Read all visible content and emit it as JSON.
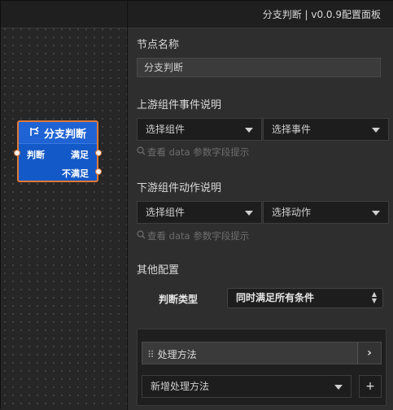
{
  "node": {
    "title": "分支判断",
    "title_icon": "branch-icon",
    "left_port_label": "判断",
    "out_labels": [
      "满足",
      "不满足"
    ]
  },
  "panel": {
    "title": "分支判断 | v0.0.9配置面板",
    "node_name_label": "节点名称",
    "node_name_value": "分支判断",
    "upstream": {
      "label": "上游组件事件说明",
      "component_select": "选择组件",
      "event_select": "选择事件",
      "hint": "查看 data 参数字段提示"
    },
    "downstream": {
      "label": "下游组件动作说明",
      "component_select": "选择组件",
      "action_select": "选择动作",
      "hint": "查看 data 参数字段提示"
    },
    "other": {
      "label": "其他配置",
      "judge_type_label": "判断类型",
      "judge_type_value": "同时满足所有条件"
    },
    "handlers": {
      "item_label": "处理方法",
      "add_select": "新增处理方法",
      "add_button": "+",
      "expand": "›"
    }
  },
  "colors": {
    "node_fill": "#1459c8",
    "node_border": "#e07a38",
    "panel_bg": "#2e2e2e"
  }
}
